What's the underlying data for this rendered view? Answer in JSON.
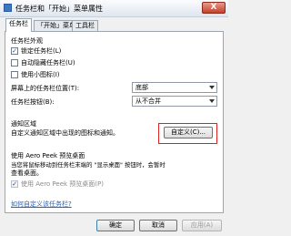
{
  "window": {
    "title": "任务栏和「开始」菜单属性",
    "close_label": "X"
  },
  "tabs": [
    {
      "label": "任务栏",
      "active": true
    },
    {
      "label": "「开始」菜单",
      "active": false
    },
    {
      "label": "工具栏",
      "active": false
    }
  ],
  "appearance": {
    "group_label": "任务栏外观",
    "lock_label": "锁定任务栏(L)",
    "lock_checked": true,
    "autohide_label": "自动隐藏任务栏(U)",
    "autohide_checked": false,
    "small_icons_label": "使用小图标(I)",
    "small_icons_checked": false,
    "position_label": "屏幕上的任务栏位置(T):",
    "position_value": "底部",
    "buttons_label": "任务栏按钮(B):",
    "buttons_value": "从不合并"
  },
  "notification": {
    "group_label": "通知区域",
    "description": "自定义通知区域中出现的图标和通知。",
    "customize_button": "自定义(C)..."
  },
  "aero_peek": {
    "group_label": "使用 Aero Peek 预览桌面",
    "description_line1": "当您将鼠标移动到任务栏末端的 \"显示桌面\" 按钮时，会暂时",
    "description_line2": "查看桌面。",
    "checkbox_label": "使用 Aero Peek 预览桌面(P)",
    "checkbox_checked": true
  },
  "help_link": "如何自定义该任务栏?",
  "footer": {
    "ok": "确定",
    "cancel": "取消",
    "apply": "应用(A)"
  }
}
